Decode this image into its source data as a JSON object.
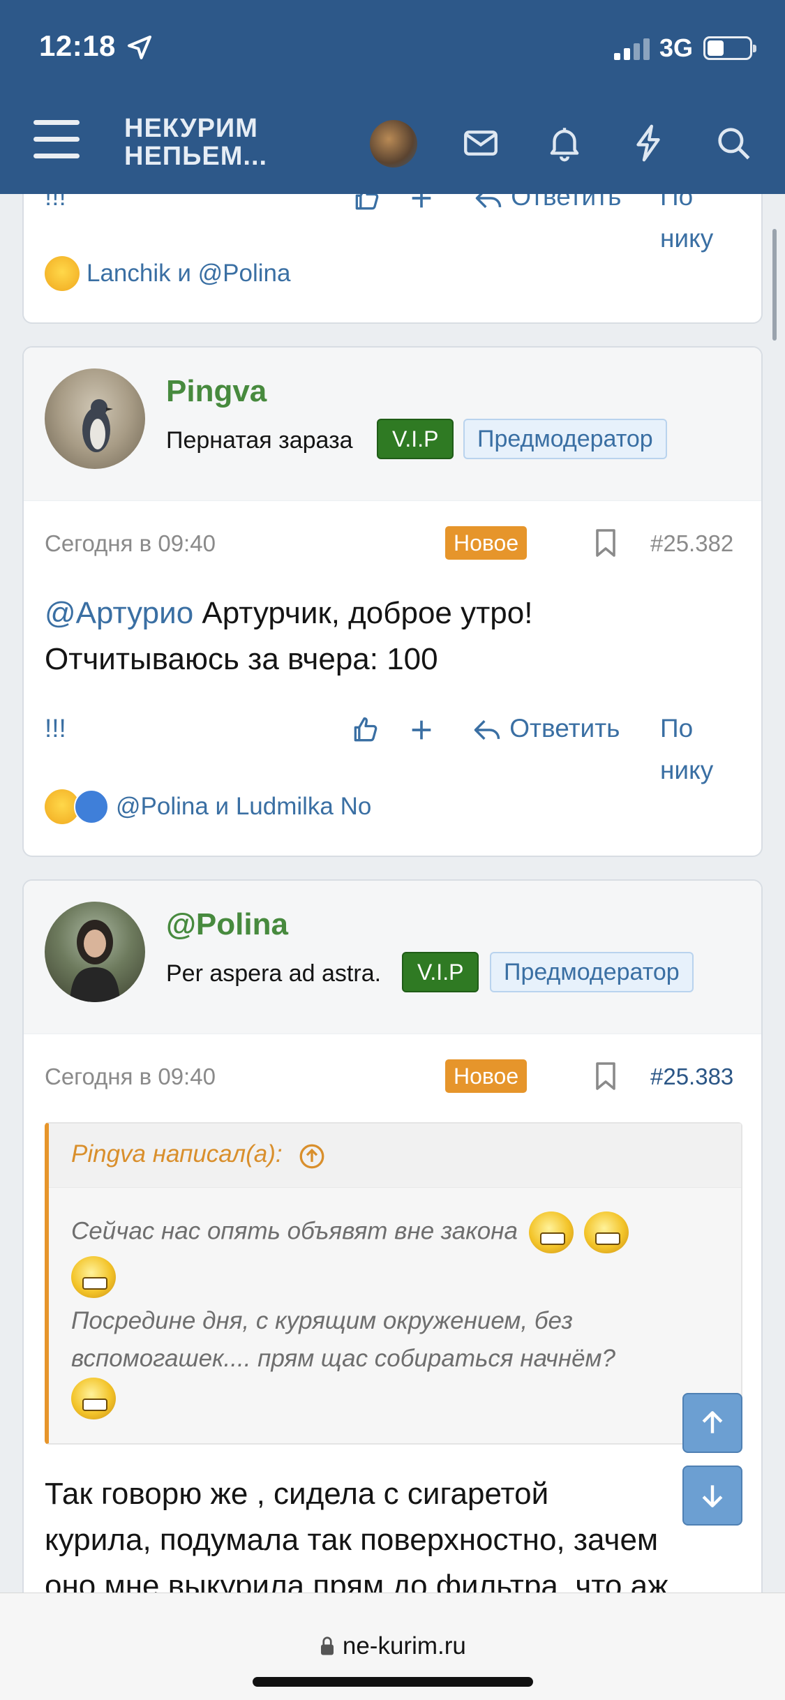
{
  "status_bar": {
    "time": "12:18",
    "network": "3G",
    "battery_level": 0.4
  },
  "nav": {
    "logo_line1": "НЕКУРИМ",
    "logo_line2": "НЕПЬЕМ..."
  },
  "top_partial": {
    "actions": {
      "exclaim": "!!!",
      "reply": "Ответить",
      "by_nick": "По нику"
    },
    "reactions_text": "Lanchik и @Polina"
  },
  "posts": [
    {
      "author": "Pingva",
      "user_title": "Пернатая зараза",
      "badge_vip": "V.I.P",
      "badge_role": "Предмодератор",
      "time": "Сегодня в 09:40",
      "new_label": "Новое",
      "number": "#25.382",
      "mention": "@Артурио",
      "text_line1": " Артурчик, доброе утро!",
      "text_line2": "Отчитываюсь за вчера: 100",
      "actions": {
        "exclaim": "!!!",
        "reply": "Ответить",
        "by_nick": "По нику"
      },
      "reactions_text": "@Polina и Ludmilka No"
    },
    {
      "author": "@Polina",
      "user_title": "Per aspera ad astra.",
      "badge_vip": "V.I.P",
      "badge_role": "Предмодератор",
      "time": "Сегодня в 09:40",
      "new_label": "Новое",
      "number": "#25.383",
      "quote_author": "Pingva написал(а):",
      "quote_line1": "Сейчас нас опять объявят вне закона",
      "quote_line2": "Посредине дня, с курящим окружением, без вспомогашек.... прям щас собираться начнём?",
      "text_line1": "Так говорю же , сидела с сигаретой",
      "text_line2": "курила, подумала так поверхностно, зачем",
      "text_line3": "оно мне выкурила прям до фильтра, что аж"
    }
  ],
  "browser": {
    "url": "ne-kurim.ru"
  }
}
